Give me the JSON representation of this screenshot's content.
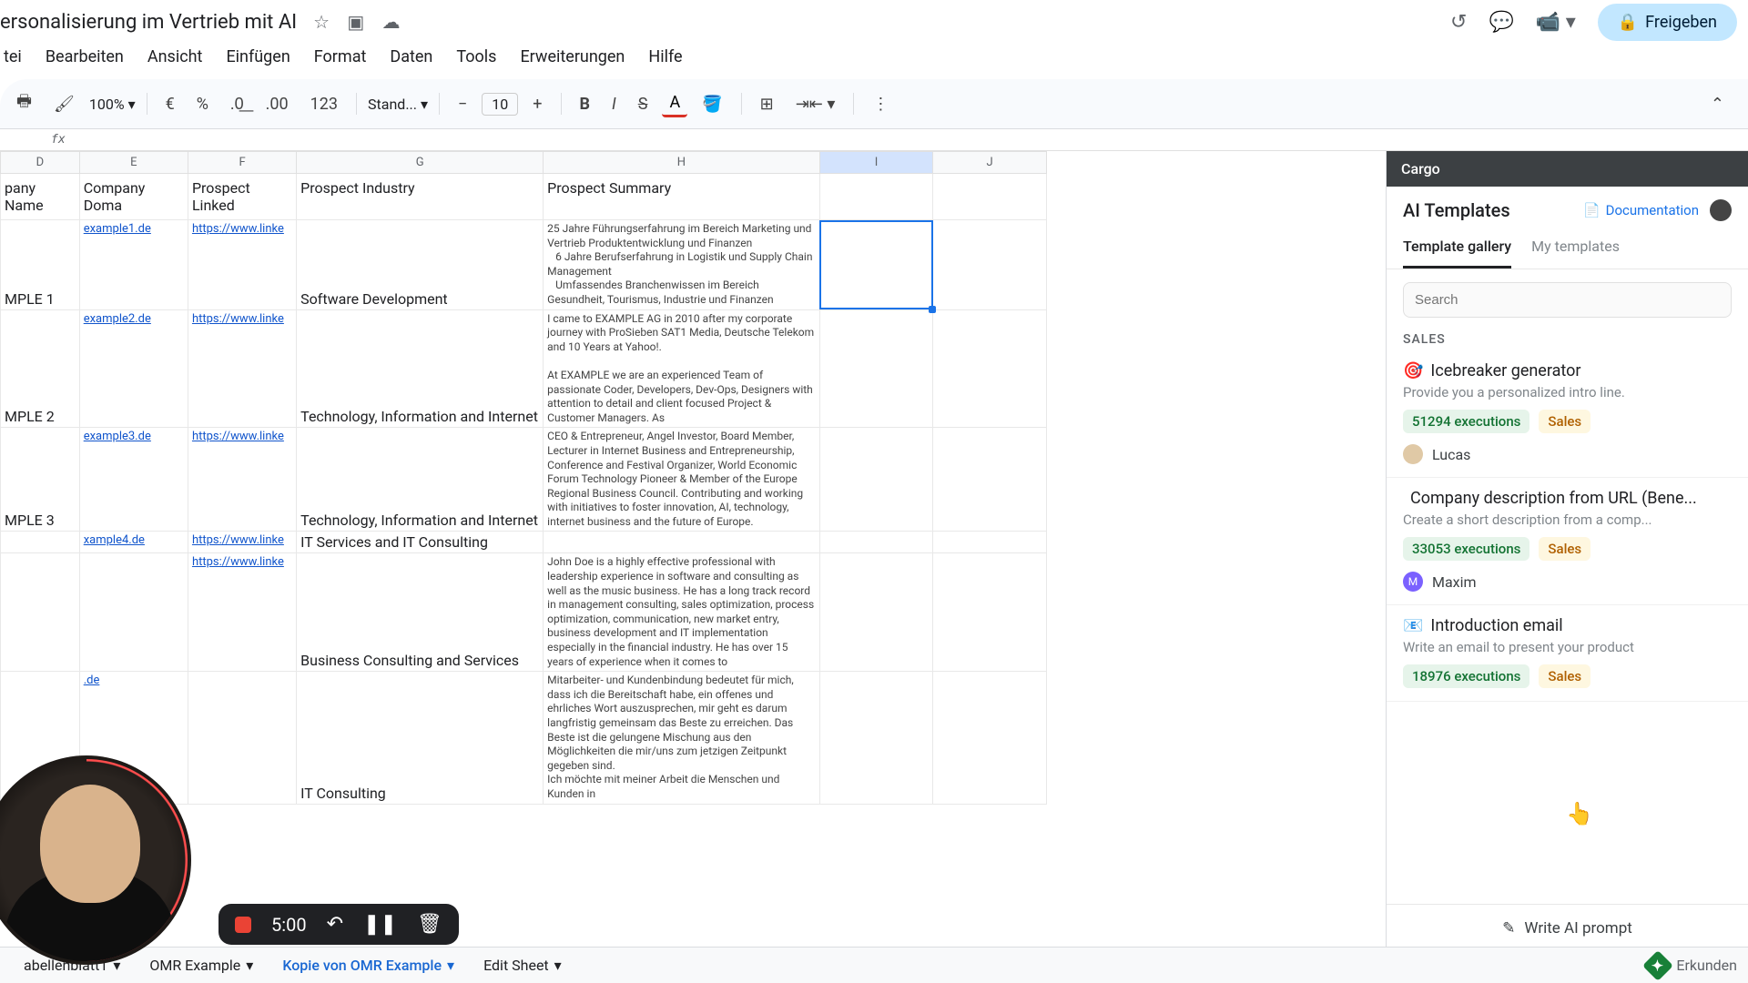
{
  "doc": {
    "title": "ersonalisierung im Vertrieb mit AI"
  },
  "menus": {
    "file": "tei",
    "edit": "Bearbeiten",
    "view": "Ansicht",
    "insert": "Einfügen",
    "format": "Format",
    "data": "Daten",
    "tools": "Tools",
    "extensions": "Erweiterungen",
    "help": "Hilfe"
  },
  "share": {
    "label": "Freigeben"
  },
  "toolbar": {
    "zoom": "100%",
    "currency": "€",
    "percent": "%",
    "num123": "123",
    "font": "Stand...",
    "minus": "−",
    "plus": "+",
    "fsize": "10",
    "collapse": "⌃"
  },
  "fx": {
    "label": "fx"
  },
  "cols": {
    "D": "D",
    "E": "E",
    "F": "F",
    "G": "G",
    "H": "H",
    "I": "I",
    "J": "J"
  },
  "headers": {
    "D": "pany Name",
    "E": "Company Doma",
    "F": "Prospect Linked",
    "G": "Prospect Industry",
    "H": "Prospect Summary"
  },
  "rows": [
    {
      "D": "MPLE 1",
      "E": "example1.de",
      "F": "https://www.linke",
      "G": "Software Development",
      "H": "25 Jahre Führungserfahrung im Bereich Marketing und Vertrieb Produktentwicklung und Finanzen\n   6 Jahre Berufserfahrung in Logistik und Supply Chain Management\n   Umfassendes Branchenwissen im Bereich Gesundheit, Tourismus, Industrie und Finanzen"
    },
    {
      "D": "MPLE 2",
      "E": "example2.de",
      "F": "https://www.linke",
      "G": "Technology, Information and Internet",
      "H": "I came to EXAMPLE AG in 2010 after my corporate journey with ProSieben SAT1 Media, Deutsche Telekom and 10 Years at Yahoo!.\n\nAt EXAMPLE we are an experienced Team of passionate Coder, Developers, Dev-Ops, Designers with attention to detail and client focused Project & Customer Managers. As"
    },
    {
      "D": "MPLE 3",
      "E": "example3.de",
      "F": "https://www.linke",
      "G": "Technology, Information and Internet",
      "H": "CEO & Entrepreneur, Angel Investor, Board Member, Lecturer in Internet Business and Entrepreneurship, Conference and Festival Organizer, World Economic Forum Technology Pioneer & Member of the Europe Regional Business Council. Contributing and working with initiatives to foster innovation, AI, technology, internet business and the future of Europe."
    },
    {
      "D": "",
      "E": "xample4.de",
      "F": "https://www.linke",
      "G": "IT Services and IT Consulting",
      "H": ""
    },
    {
      "D": "",
      "E": "",
      "F": "https://www.linke",
      "G": "Business Consulting and Services",
      "H": "John Doe is a highly effective professional with leadership experience in software and consulting as well as the music business. He has a long track record in management consulting, sales optimization, process optimization, communication, new market entry, business development and IT implementation especially in the financial industry. He has over 15 years of experience when it comes to"
    },
    {
      "D": "",
      "E": ".de",
      "F": "",
      "G": "IT Consulting",
      "H": "Mitarbeiter- und Kundenbindung bedeutet für mich, dass ich die Bereitschaft habe, ein offenes und ehrliches Wort auszusprechen, mir geht es darum langfristig gemeinsam das Beste zu erreichen. Das Beste ist die gelungene Mischung aus den Möglichkeiten die mir/uns zum jetzigen Zeitpunkt gegeben sind.\nIch möchte mit meiner Arbeit die Menschen und Kunden in"
    }
  ],
  "sidebar": {
    "brand": "Cargo",
    "title": "AI Templates",
    "doc_link": "Documentation",
    "tabs": {
      "gallery": "Template gallery",
      "mine": "My templates"
    },
    "search_placeholder": "Search",
    "section": "SALES",
    "cards": [
      {
        "icon": "🎯",
        "title": "Icebreaker generator",
        "desc": "Provide you a personalized intro line.",
        "exec": "51294 executions",
        "tag": "Sales",
        "author": "Lucas",
        "avbg": "#e0c9a6"
      },
      {
        "icon": "",
        "title": "Company description from URL (Bene...",
        "desc": "Create a short description from a comp...",
        "exec": "33053 executions",
        "tag": "Sales",
        "author": "Maxim",
        "avbg": "#7b61ff",
        "avinit": "M"
      },
      {
        "icon": "📧",
        "title": "Introduction email",
        "desc": "Write an email to present your product",
        "exec": "18976 executions",
        "tag": "Sales",
        "author": "",
        "avbg": ""
      }
    ],
    "footer": "Write AI prompt"
  },
  "bottom": {
    "t1": "abellenblatt1",
    "t2": "OMR Example",
    "t3": "Kopie von OMR Example",
    "t4": "Edit Sheet",
    "explore": "Erkunden"
  },
  "rec": {
    "time": "5:00"
  }
}
